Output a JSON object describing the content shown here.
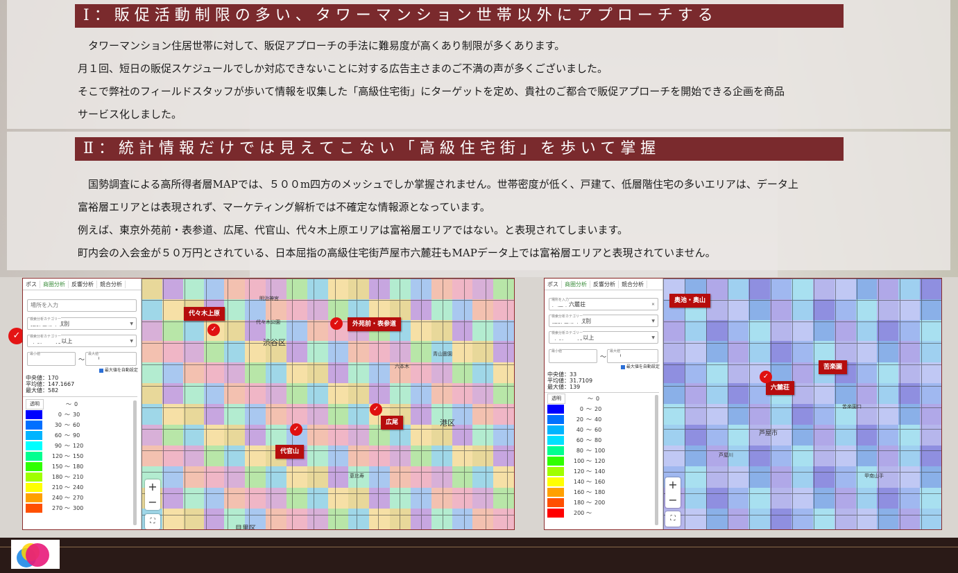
{
  "section1": {
    "heading": "Ⅰ：販促活動制限の多い、タワーマンション世帯以外にアプローチする",
    "lines": [
      "　タワーマンション住居世帯に対して、販促アプローチの手法に難易度が高くあり制限が多くあります。",
      "月１回、短日の販促スケジュールでしか対応できないことに対する広告主さまのご不満の声が多くございました。",
      "そこで弊社のフィールドスタッフが歩いて情報を収集した「高級住宅街」にターゲットを定め、貴社のご都合で販促アプローチを開始できる企画を商品",
      "サービス化しました。"
    ]
  },
  "section2": {
    "heading": "Ⅱ：統計情報だけでは見えてこない「高級住宅街」を歩いて掌握",
    "lines": [
      "　国勢調査による高所得者層MAPでは、５００m四方のメッシュでしか掌握されません。世帯密度が低く、戸建て、低層階住宅の多いエリアは、データ上",
      "富裕層エリアとは表現されず、マーケティング解析では不確定な情報源となっています。",
      "例えば、東京外苑前・表参道、広尾、代官山、代々木上原エリアは富裕層エリアではない。と表現されてしまいます。",
      "町内会の入会金が５０万円とされている、日本屈指の高級住宅街芦屋市六麓荘もMAPデータ上では富裕層エリアと表現されていません。"
    ]
  },
  "map1": {
    "tabs": [
      "ポス",
      "商圏分析",
      "反響分析",
      "競合分析"
    ],
    "active_tab": "商圏分析",
    "place_input_placeholder": "場所を入力",
    "category_caption": "検索分析カテゴリー",
    "category_value": "推計世帯年収別",
    "sub_category_caption": "検索分析カテゴリー",
    "sub_category_value": "年収1500万以上",
    "min_caption": "最小値",
    "min_value": "0",
    "tilde": "～",
    "max_caption": "最大値",
    "max_value": "300",
    "auto_max_label": "最大値を自動設定",
    "median": "中央値：170",
    "mean": "平均値：147.1667",
    "maximum": "最大値：582",
    "transparent_label": "透明",
    "legend": [
      {
        "color": "#ffffff",
        "from": "",
        "to": "0"
      },
      {
        "color": "#0000ff",
        "from": "0",
        "to": "30"
      },
      {
        "color": "#0070ff",
        "from": "30",
        "to": "60"
      },
      {
        "color": "#00b4ff",
        "from": "60",
        "to": "90"
      },
      {
        "color": "#00ffff",
        "from": "90",
        "to": "120"
      },
      {
        "color": "#00ff90",
        "from": "120",
        "to": "150"
      },
      {
        "color": "#30ff00",
        "from": "150",
        "to": "180"
      },
      {
        "color": "#a0ff00",
        "from": "180",
        "to": "210"
      },
      {
        "color": "#ffff00",
        "from": "210",
        "to": "240"
      },
      {
        "color": "#ffa000",
        "from": "240",
        "to": "270"
      },
      {
        "color": "#ff5000",
        "from": "270",
        "to": "300"
      }
    ],
    "places": [
      "代々木上原",
      "外苑前・表参道",
      "広尾",
      "代官山"
    ],
    "map_labels": [
      "渋谷区",
      "港区",
      "目黒区",
      "明治神宮",
      "代々木公園",
      "恵比寿",
      "六本木",
      "青山霊園"
    ],
    "zoom_in": "+",
    "zoom_out": "−",
    "fullscreen": "⛶"
  },
  "map2": {
    "tabs": [
      "ポス",
      "商圏分析",
      "反響分析",
      "競合分析"
    ],
    "active_tab": "商圏分析",
    "place_caption": "場所を入力",
    "place_value": "芦屋市六麓荘",
    "category_caption": "検索分析カテゴリー",
    "category_value": "推計世帯年収別",
    "sub_category_caption": "検索分析カテゴリー",
    "sub_category_value": "年収1500万以上",
    "min_caption": "最小値",
    "min_value": "0",
    "tilde": "～",
    "max_caption": "最大値",
    "max_value": "200",
    "auto_max_label": "最大値を自動設定",
    "median": "中央値：33",
    "mean": "平均値：31.7109",
    "maximum": "最大値：139",
    "transparent_label": "透明",
    "legend": [
      {
        "color": "#ffffff",
        "from": "",
        "to": "0"
      },
      {
        "color": "#0000ff",
        "from": "0",
        "to": "20"
      },
      {
        "color": "#0070ff",
        "from": "20",
        "to": "40"
      },
      {
        "color": "#00b4ff",
        "from": "40",
        "to": "60"
      },
      {
        "color": "#00e0ff",
        "from": "60",
        "to": "80"
      },
      {
        "color": "#00ff90",
        "from": "80",
        "to": "100"
      },
      {
        "color": "#30ff00",
        "from": "100",
        "to": "120"
      },
      {
        "color": "#a0ff00",
        "from": "120",
        "to": "140"
      },
      {
        "color": "#ffff00",
        "from": "140",
        "to": "160"
      },
      {
        "color": "#ffa000",
        "from": "160",
        "to": "180"
      },
      {
        "color": "#ff5000",
        "from": "180",
        "to": "200"
      },
      {
        "color": "#ff0000",
        "from": "200",
        "to": ""
      }
    ],
    "places": [
      "奥池・奥山",
      "苦楽園",
      "六麓荘"
    ],
    "map_labels": [
      "芦屋市",
      "苦楽園口",
      "芦屋川",
      "甲南山手"
    ],
    "zoom_in": "+",
    "zoom_out": "−",
    "fullscreen": "⛶"
  },
  "colors": {
    "heading_bg": "#7a2a2d",
    "place_badge": "#b60d0d",
    "pin": "#e01010",
    "footer_bg": "#2a1a17"
  }
}
